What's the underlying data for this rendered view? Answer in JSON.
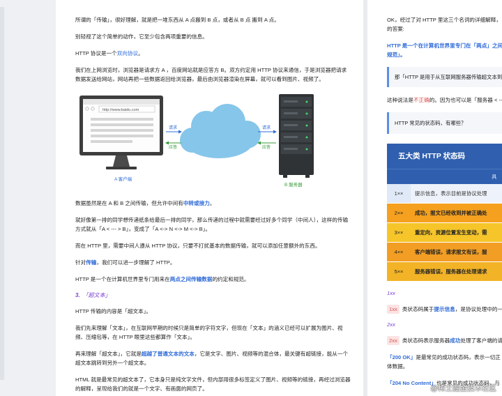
{
  "left": {
    "p1": "所谓的「传输」，很好理解，就是把一堆东西从 A 点搬到 B 点，或者从 B 点 搬到 A 点。",
    "p2": "别轻视了这个简单的动作，它至少包含两项重要的信息。",
    "p3_pre": "HTTP 协议是一个",
    "p3_link": "双向协议",
    "p3_post": "。",
    "p4": "我们在上网浏览时，浏览器是请求方 A ，百度网站就是应答方 B。双方约定用 HTTP 协议来通信，于是浏览器把请求数据发送给网站，网站再把一些数据返回给浏览器，最后由浏览器渲染在屏幕，就可以看到图片、视频了。",
    "diagram": {
      "url": "http://www.baidu.com",
      "request": "请求",
      "response": "应答",
      "client": "A 客户端",
      "server": "B 服务器"
    },
    "p5_pre": "数据虽然是在 A 和 B 之间传输，但允许中间有",
    "p5_link": "中转或接力",
    "p5_post": "。",
    "p6": "就好像第一排的同学想传递纸条给最后一排的同学，那么传递的过程中就需要经过好多个同学（中间人），这样的传输方式就从「A < --- > B」，变成了「A <-> N <-> M <-> B」。",
    "p7": "而在 HTTP 里，需要中间人遵从 HTTP 协议，只要不打扰基本的数据传输，就可以添加任意额外的东西。",
    "p8_pre": "针对",
    "p8_link": "传输",
    "p8_post": "，我们可以进一步理解了 HTTP。",
    "p9_pre": "HTTP 是一个在计算机世界里专门用来在",
    "p9_link": "两点之间传输数据",
    "p9_post": "的约定和规范。",
    "h3_num": "3.",
    "h3_text": "「超文本」",
    "p10": "HTTP 传输的内容是「超文本」。",
    "p11": "我们先来理解「文本」，在互联网早期的时候只是简单的字符文字，但现在「文本」的涵义已经可以扩展为图片、视频、压缩包等，在 HTTP 眼里这些都算作「文本」。",
    "p12_pre": "再来理解「超文本」，它就是",
    "p12_link": "超越了普通文本的文本",
    "p12_post": "，它是文字、图片、视频等的混合体，最关键有超链接，能从一个超文本跳转到另外一个超文本。",
    "p13": "HTML 就是最常见的超文本了，它本身只是纯文字文件，但内部用很多标签定义了图片、视频等的链接，再经过浏览器的解释，呈现给我们的就是一个文字、有画面的网页了。"
  },
  "right": {
    "p1": "OK，经过了对 HTTP 里这三个名词的详细解释，",
    "p1b": "的答案:",
    "p2_line1": "HTTP 是一个在计算机世界里专门在「两点」之间",
    "p2_line2": "规范」。",
    "quote1": "那「HTTP 是用于从互联网服务器传输超文本到本",
    "p3_pre": "这种说法是",
    "p3_red": "不正确",
    "p3_post": "的。因为也可以是「服务器 < -- >",
    "quote2": "HTTP 常见的状态码，有哪些？",
    "status_title": "五大类 HTTP 状态码",
    "status_head": "具",
    "rows": [
      {
        "code": "1××",
        "desc": "提示信息，表示目前是协议处理"
      },
      {
        "code": "2××",
        "desc": "成功，报文已经收到并被正确处"
      },
      {
        "code": "3××",
        "desc": "重定向，资源位置发生变动，需"
      },
      {
        "code": "4××",
        "desc": "客户端错误，请求报文有误，服"
      },
      {
        "code": "5××",
        "desc": "服务器错误，服务器在处理请求"
      }
    ],
    "l1": "1xx",
    "l1_tag": "1xx",
    "l1_text_pre": "类状态码属于",
    "l1_link": "提示信息",
    "l1_text_post": "，是协议处理中的一",
    "l2": "2xx",
    "l2_tag": "2xx",
    "l2_text_pre": "类状态码表示服务器",
    "l2_link": "成功",
    "l2_text_post": "处理了客户端的请",
    "p200_code": "「200 OK」",
    "p200_text": "是最常见的成功状态码，表示一切正",
    "p200_text2": "体数据。",
    "p204_code": "「204 No Content」",
    "p204_text": "也是常见的成功状态码，与"
  },
  "watermark": "@稀土掘金技术社区"
}
